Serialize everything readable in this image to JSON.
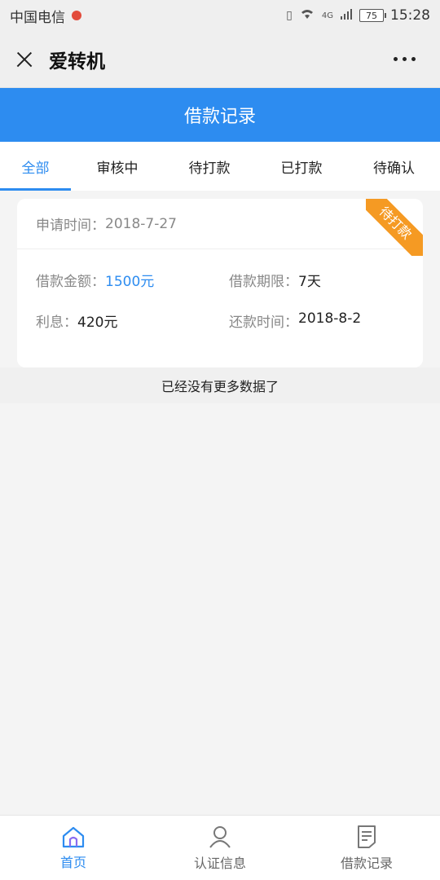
{
  "status_bar": {
    "carrier": "中国电信",
    "network": "4G",
    "battery": "75",
    "time": "15:28"
  },
  "title_bar": {
    "title": "爱转机"
  },
  "page_header": {
    "title": "借款记录"
  },
  "tabs": [
    {
      "label": "全部",
      "active": true
    },
    {
      "label": "审核中",
      "active": false
    },
    {
      "label": "待打款",
      "active": false
    },
    {
      "label": "已打款",
      "active": false
    },
    {
      "label": "待确认",
      "active": false
    }
  ],
  "card": {
    "apply_time_label": "申请时间：",
    "apply_time": "2018-7-27",
    "status_ribbon": "待打款",
    "amount_label": "借款金额：",
    "amount": "1500元",
    "term_label": "借款期限：",
    "term": "7天",
    "interest_label": "利息：",
    "interest": "420元",
    "repay_label": "还款时间：",
    "repay_time": "2018-8-2"
  },
  "list_footer": "已经没有更多数据了",
  "bottom_nav": [
    {
      "label": "首页",
      "icon": "home-icon",
      "active": true
    },
    {
      "label": "认证信息",
      "icon": "user-icon",
      "active": false
    },
    {
      "label": "借款记录",
      "icon": "document-icon",
      "active": false
    }
  ],
  "colors": {
    "accent": "#2d8cf0",
    "ribbon": "#f59a23"
  }
}
